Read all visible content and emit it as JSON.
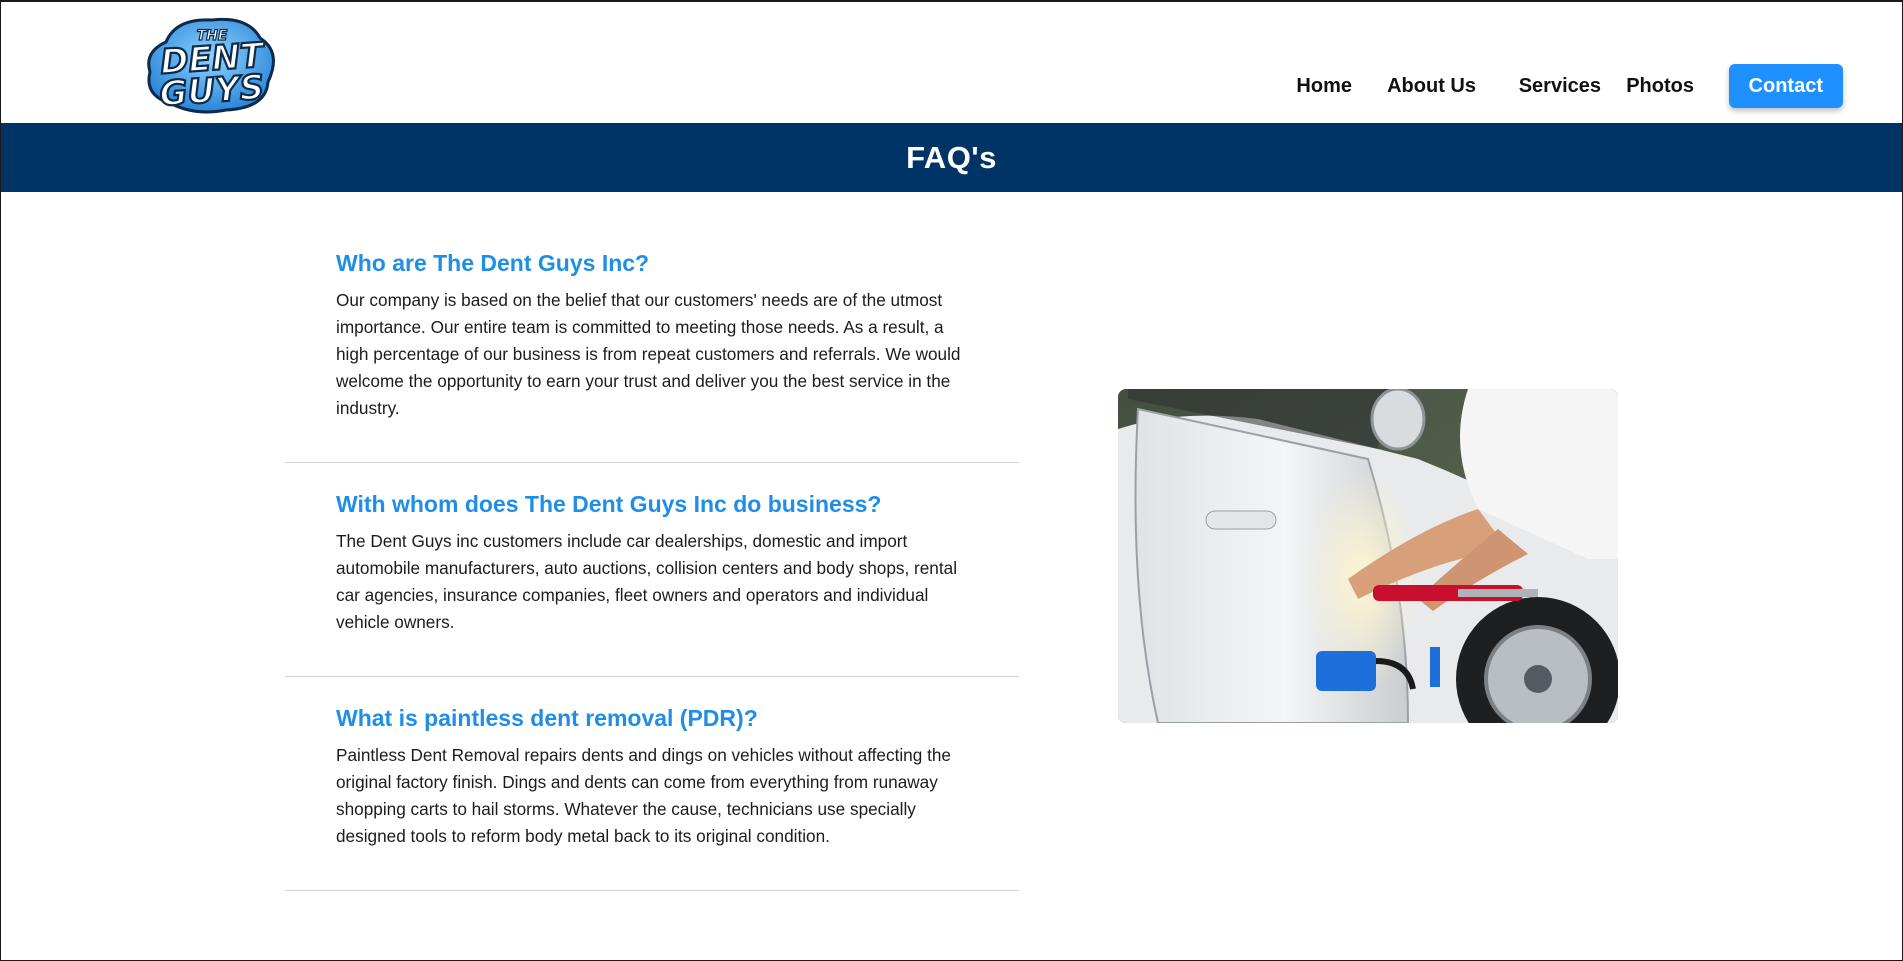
{
  "brand": {
    "logo_top": "THE",
    "logo_line1": "DENT",
    "logo_line2": "GUYS"
  },
  "nav": {
    "items": [
      {
        "label": "Home"
      },
      {
        "label": "About Us"
      },
      {
        "label": "Services"
      },
      {
        "label": "Photos"
      }
    ],
    "contact_label": "Contact"
  },
  "page": {
    "title": "FAQ's"
  },
  "faq": [
    {
      "question": "Who are The Dent Guys Inc?",
      "answer": "Our company is based on the belief that our customers' needs are of the utmost importance. Our entire team is committed to meeting those needs. As a result, a high percentage of our business is from repeat customers and referrals. We would welcome the opportunity to earn your trust and deliver you the best service in the industry."
    },
    {
      "question": "With whom does The Dent Guys Inc do business?",
      "answer": "The Dent Guys inc customers include car dealerships, domestic and import automobile manufacturers, auto auctions, collision centers and body shops, rental car agencies, insurance companies, fleet owners and operators and individual vehicle owners."
    },
    {
      "question": "What is paintless dent removal (PDR)?",
      "answer": "Paintless Dent Removal repairs dents and dings on vehicles without affecting the original factory finish. Dings and dents can come from everything from runaway shopping carts to hail storms. Whatever the cause, technicians use specially designed tools to reform body metal back to its original condition."
    }
  ],
  "colors": {
    "banner": "#003366",
    "accent": "#1e90ff",
    "question": "#1e8ee6"
  },
  "image": {
    "icon": "photo-technician-repairing-car-door"
  }
}
